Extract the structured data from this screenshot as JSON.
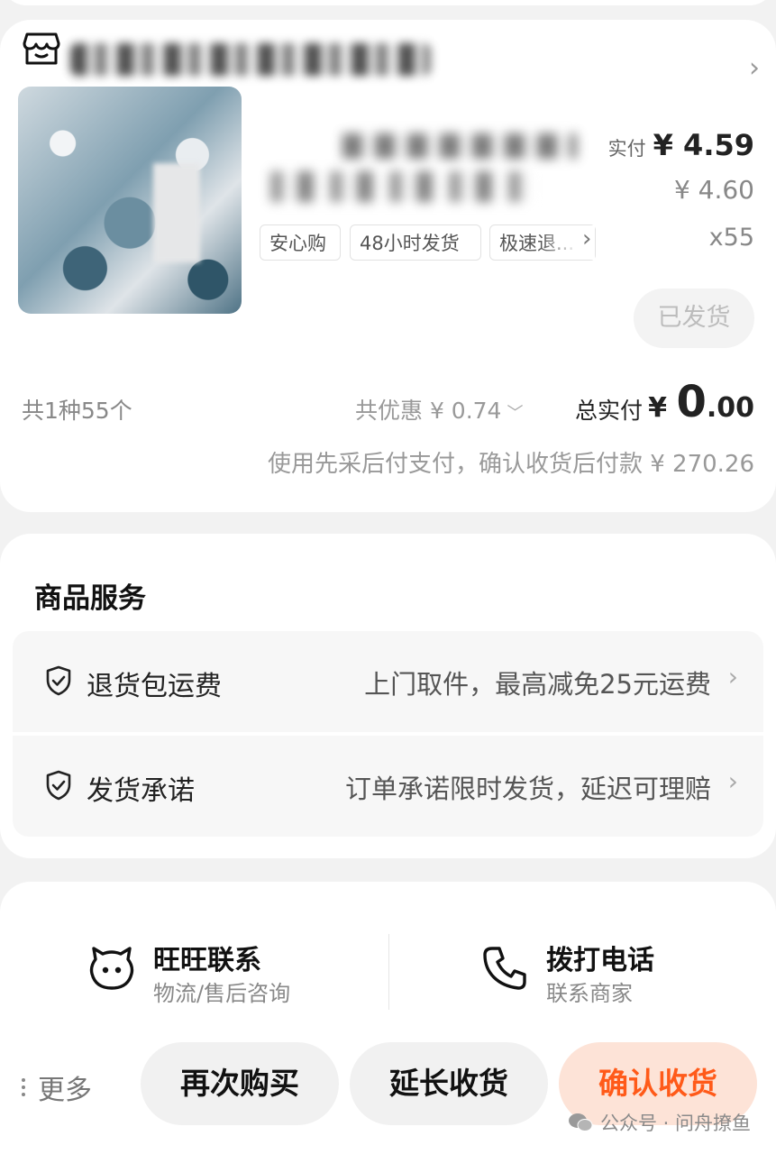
{
  "order": {
    "paid_label": "实付",
    "paid_price": "¥ 4.59",
    "original_price": "¥ 4.60",
    "quantity": "x55",
    "tags": [
      "安心购",
      "48小时发货",
      "极速退..."
    ],
    "shipped_status": "已发货",
    "total_count": "共1种55个",
    "discount": "共优惠 ¥ 0.74",
    "total_label": "总实付",
    "total_currency": "¥ ",
    "total_int": "0",
    "total_dec": ".00",
    "pay_note": "使用先采后付支付，确认收货后付款 ¥ 270.26"
  },
  "services": {
    "title": "商品服务",
    "items": [
      {
        "label": "退货包运费",
        "desc": "上门取件，最高减免25元运费"
      },
      {
        "label": "发货承诺",
        "desc": "订单承诺限时发货，延迟可理赔"
      }
    ]
  },
  "contact": {
    "wangwang_title": "旺旺联系",
    "wangwang_sub": "物流/售后咨询",
    "phone_title": "拨打电话",
    "phone_sub": "联系商家"
  },
  "actions": {
    "more": "更多",
    "rebuy": "再次购买",
    "extend": "延长收货",
    "confirm": "确认收货"
  },
  "watermark": "公众号 · 问舟撩鱼",
  "colors": {
    "accent": "#ff5a19",
    "accent_bg": "#fde3d7",
    "page_bg": "#f2f2f2"
  },
  "icons": [
    "store-icon",
    "shield-check-icon",
    "wangwang-icon",
    "phone-icon",
    "chevron-right-icon",
    "chevron-down-icon",
    "more-dots-icon",
    "wechat-icon"
  ]
}
